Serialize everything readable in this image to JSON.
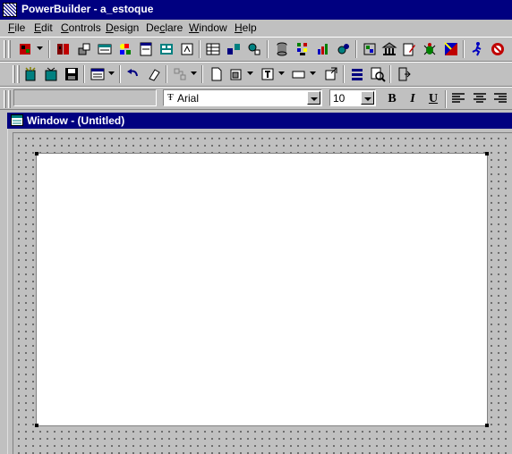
{
  "app": {
    "title": "PowerBuilder - a_estoque"
  },
  "menu": {
    "items": [
      {
        "key": "F",
        "rest": "ile"
      },
      {
        "key": "E",
        "rest": "dit"
      },
      {
        "key": "C",
        "rest": "ontrols"
      },
      {
        "key": "D",
        "rest": "esign"
      },
      {
        "pre": "De",
        "key": "c",
        "rest": "lare"
      },
      {
        "key": "W",
        "rest": "indow"
      },
      {
        "key": "H",
        "rest": "elp"
      }
    ]
  },
  "format_bar": {
    "style_value": "",
    "font_name": "Arial",
    "font_size": "10",
    "bold_label": "B",
    "italic_label": "I",
    "underline_label": "U"
  },
  "child_window": {
    "title": "Window - (Untitled)"
  },
  "colors": {
    "titlebar": "#000080",
    "face": "#c0c0c0",
    "canvas": "#ffffff"
  }
}
